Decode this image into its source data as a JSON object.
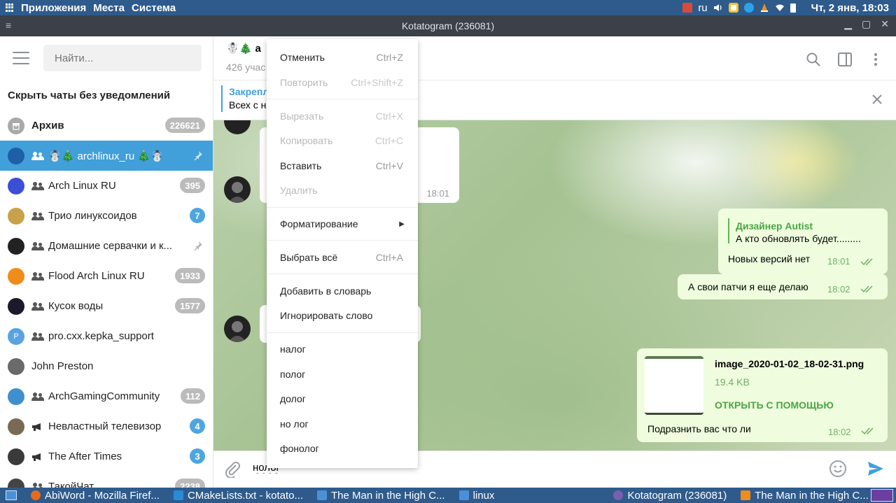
{
  "top_panel": {
    "menus": [
      "Приложения",
      "Места",
      "Система"
    ],
    "keyboard_layout": "ru",
    "clock": "Чт, 2 янв, 18:03"
  },
  "window": {
    "title": "Kotatogram (236081)"
  },
  "sidebar": {
    "search_placeholder": "Найти...",
    "hide_muted_label": "Скрыть чаты без уведомлений",
    "archive": {
      "label": "Архив",
      "count": "226621"
    },
    "chats": [
      {
        "name": "☃️🎄 archlinux_ru 🎄☃️",
        "kind": "group",
        "badge": "",
        "pinned": true,
        "active": true,
        "avatar_color": "#1f5fa8"
      },
      {
        "name": "Arch Linux RU",
        "kind": "group",
        "badge": "395",
        "badge_style": "muted",
        "avatar_color": "#3b4fd6"
      },
      {
        "name": "Трио линуксоидов",
        "kind": "group",
        "badge": "7",
        "badge_style": "unread",
        "avatar_color": "#c8a24a"
      },
      {
        "name": "Домашние сервачки и к...",
        "kind": "group",
        "badge": "",
        "pinned": true,
        "avatar_color": "#222222"
      },
      {
        "name": "Flood Arch Linux RU",
        "kind": "group",
        "badge": "1933",
        "badge_style": "muted",
        "avatar_color": "#f08c1a"
      },
      {
        "name": "Кусок воды",
        "kind": "group",
        "badge": "1577",
        "badge_style": "muted",
        "avatar_color": "#1a1a2a"
      },
      {
        "name": "pro.cxx.kepka_support",
        "kind": "group",
        "badge": "",
        "avatar_color": "#5aa3e0",
        "avatar_letter": "P"
      },
      {
        "name": "John Preston",
        "kind": "user",
        "badge": "",
        "avatar_color": "#6a6a6a"
      },
      {
        "name": "ArchGamingCommunity",
        "kind": "group",
        "badge": "112",
        "badge_style": "muted",
        "avatar_color": "#3e8fd0"
      },
      {
        "name": "Невластный телевизор",
        "kind": "channel",
        "badge": "4",
        "badge_style": "unread",
        "avatar_color": "#7a6a55"
      },
      {
        "name": "The After Times",
        "kind": "channel",
        "badge": "3",
        "badge_style": "unread",
        "avatar_color": "#3a3a3a"
      },
      {
        "name": "ТакойЧат",
        "kind": "group",
        "badge": "2238",
        "badge_style": "muted",
        "avatar_color": "#444444"
      }
    ]
  },
  "chat": {
    "title": "☃️🎄 a",
    "subtitle": "426 учас",
    "pinned_title": "Закрепл",
    "pinned_text": "Всех с н",
    "messages": {
      "in1_time": "18:01",
      "out_reply_author": "Дизайнер Autist",
      "out_reply_text": "А кто обновлять будет.........",
      "out1_text": "Новых версий нет",
      "out1_time": "18:01",
      "out2_text": "А свои патчи я еще делаю",
      "out2_time": "18:02",
      "file_name": "image_2020-01-02_18-02-31.png",
      "file_size": "19.4 KB",
      "file_action": "ОТКРЫТЬ С ПОМОЩЬЮ",
      "file_caption": "Подразнить вас что ли",
      "file_time": "18:02"
    },
    "composer_value": "нолог"
  },
  "context_menu": {
    "undo": {
      "label": "Отменить",
      "shortcut": "Ctrl+Z"
    },
    "redo": {
      "label": "Повторить",
      "shortcut": "Ctrl+Shift+Z"
    },
    "cut": {
      "label": "Вырезать",
      "shortcut": "Ctrl+X"
    },
    "copy": {
      "label": "Копировать",
      "shortcut": "Ctrl+C"
    },
    "paste": {
      "label": "Вставить",
      "shortcut": "Ctrl+V"
    },
    "delete": {
      "label": "Удалить"
    },
    "formatting": {
      "label": "Форматирование"
    },
    "select_all": {
      "label": "Выбрать всё",
      "shortcut": "Ctrl+A"
    },
    "add_to_dict": {
      "label": "Добавить в словарь"
    },
    "ignore_word": {
      "label": "Игнорировать слово"
    },
    "suggestions": [
      "налог",
      "полог",
      "долог",
      "но лог",
      "фонолог"
    ]
  },
  "taskbar": {
    "items": [
      {
        "label": "AbiWord - Mozilla Firef...",
        "icon": "firefox-icon",
        "color": "#e66b1a"
      },
      {
        "label": "CMakeLists.txt - kotato...",
        "icon": "vscode-icon",
        "color": "#2b8ad8"
      },
      {
        "label": "The Man in the High C...",
        "icon": "folder-icon",
        "color": "#4a90d9"
      },
      {
        "label": "linux",
        "icon": "folder-icon",
        "color": "#4a90d9"
      },
      {
        "label": "Kotatogram (236081)",
        "icon": "kotatogram-icon",
        "color": "#7a5fb0"
      },
      {
        "label": "The Man in the High C...",
        "icon": "vlc-icon",
        "color": "#f08c1a"
      }
    ]
  }
}
